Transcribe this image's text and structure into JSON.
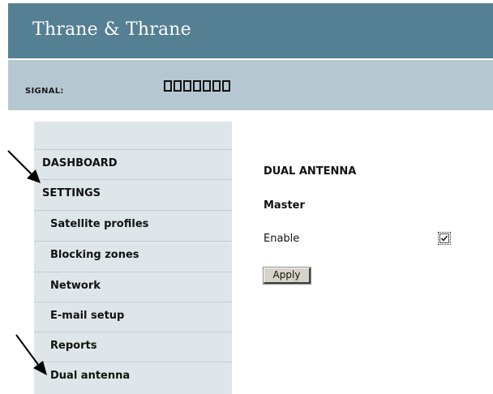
{
  "header": {
    "brand": "Thrane & Thrane"
  },
  "status": {
    "signal_label": "SIGNAL:",
    "signal_blocks_total": 7,
    "signal_blocks_filled": 0
  },
  "sidebar": {
    "items": [
      {
        "label": "DASHBOARD",
        "level": "top"
      },
      {
        "label": "SETTINGS",
        "level": "top"
      },
      {
        "label": "Satellite profiles",
        "level": "sub"
      },
      {
        "label": "Blocking zones",
        "level": "sub"
      },
      {
        "label": "Network",
        "level": "sub"
      },
      {
        "label": "E-mail setup",
        "level": "sub"
      },
      {
        "label": "Reports",
        "level": "sub"
      },
      {
        "label": "Dual antenna",
        "level": "sub"
      }
    ]
  },
  "content": {
    "title": "DUAL ANTENNA",
    "subtitle": "Master",
    "enable_label": "Enable",
    "enable_checked": true,
    "apply_label": "Apply"
  },
  "colors": {
    "header_bg": "#557f93",
    "signal_bar_bg": "#b5c8d2",
    "sidebar_bg": "#dfe6ea"
  },
  "annotations": {
    "arrow_icon": "pointer-arrow-icon"
  }
}
